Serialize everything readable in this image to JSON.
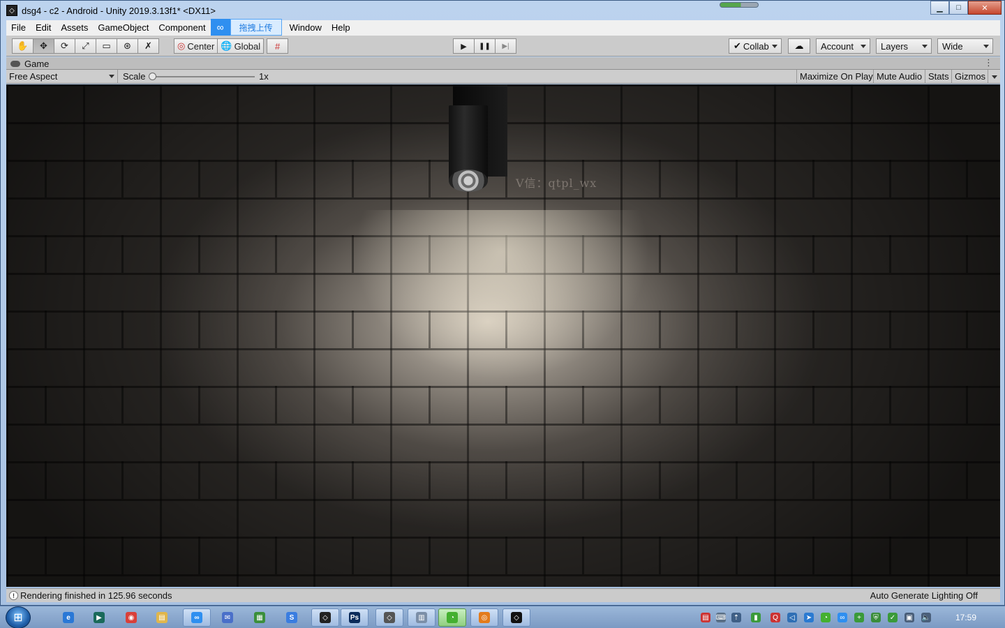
{
  "window": {
    "title": "dsg4 - c2 - Android - Unity 2019.3.13f1* <DX11>",
    "controls": {
      "minimize": "▁",
      "maximize": "□",
      "close": "✕"
    }
  },
  "menu": {
    "items": [
      "File",
      "Edit",
      "Assets",
      "GameObject",
      "Component"
    ],
    "upload_tab": "拖拽上传",
    "items_after": [
      "Window",
      "Help"
    ]
  },
  "toolbar": {
    "tools": [
      {
        "name": "hand-tool",
        "glyph": "✋"
      },
      {
        "name": "move-tool",
        "glyph": "✥"
      },
      {
        "name": "rotate-tool",
        "glyph": "⟳"
      },
      {
        "name": "scale-tool",
        "glyph": "⤢"
      },
      {
        "name": "rect-tool",
        "glyph": "▭"
      },
      {
        "name": "transform-tool",
        "glyph": "⊛"
      },
      {
        "name": "custom-tool",
        "glyph": "✗"
      }
    ],
    "pivot_mode": "Center",
    "pivot_rotation": "Global",
    "snap_glyph": "#",
    "play_glyph": "▶",
    "pause_glyph": "❚❚",
    "step_glyph": "▶|",
    "collab": "Collab",
    "cloud_glyph": "☁",
    "account": "Account",
    "layers": "Layers",
    "layout": "Wide"
  },
  "game_panel": {
    "tab_label": "Game",
    "kebab": "⋮",
    "aspect": "Free Aspect",
    "scale_label": "Scale",
    "scale_value": "1x",
    "scale_level": 0.0,
    "buttons": [
      "Maximize On Play",
      "Mute Audio",
      "Stats",
      "Gizmos"
    ]
  },
  "viewport": {
    "watermark": "V信：qtpl_wx"
  },
  "status": {
    "icon": "!",
    "message": "Rendering finished in 125.96 seconds",
    "lighting": "Auto Generate Lighting Off"
  },
  "taskbar": {
    "start_glyph": "⊞",
    "apps": [
      {
        "name": "ie-icon",
        "glyph": "e",
        "color": "#2a78d6",
        "open": false
      },
      {
        "name": "editor-icon",
        "glyph": "▶",
        "color": "#1a6a5a",
        "open": false
      },
      {
        "name": "chrome-icon",
        "glyph": "◉",
        "color": "#d9403a",
        "open": false
      },
      {
        "name": "folder-icon",
        "glyph": "▤",
        "color": "#e0b64c",
        "open": false
      },
      {
        "name": "baidu-netdisk-icon",
        "glyph": "∞",
        "color": "#2f8ff0",
        "open": true
      },
      {
        "name": "mail-icon",
        "glyph": "✉",
        "color": "#4a6fc9",
        "open": false
      },
      {
        "name": "chart-app-icon",
        "glyph": "▦",
        "color": "#3b8f3b",
        "open": false
      },
      {
        "name": "sogou-icon",
        "glyph": "S",
        "color": "#3a7de0",
        "open": false
      },
      {
        "name": "unity-hub-icon",
        "glyph": "◇",
        "color": "#222222",
        "open": true
      },
      {
        "name": "photoshop-icon",
        "glyph": "Ps",
        "color": "#0b2b5a",
        "open": true
      },
      {
        "name": "unity-task-icon",
        "glyph": "◇",
        "color": "#555555",
        "open": true
      },
      {
        "name": "calculator-icon",
        "glyph": "▥",
        "color": "#7c8fa8",
        "open": true
      },
      {
        "name": "wechat-icon",
        "glyph": "◔",
        "color": "#44b030",
        "open": true,
        "highlight": true
      },
      {
        "name": "browser-icon",
        "glyph": "◎",
        "color": "#e37b1b",
        "open": true
      },
      {
        "name": "unity-editor-icon",
        "glyph": "◇",
        "color": "#111111",
        "open": true
      }
    ],
    "tray": [
      {
        "name": "doc-tray-icon",
        "glyph": "▤",
        "color": "#cc3333"
      },
      {
        "name": "keyboard-tray-icon",
        "glyph": "⌨",
        "color": "#5a6f86"
      },
      {
        "name": "arrow-tray-icon",
        "glyph": "⇡",
        "color": "#3f5f86"
      },
      {
        "name": "battery-tray-icon",
        "glyph": "▮",
        "color": "#3a9a3a"
      },
      {
        "name": "qq-tray-icon",
        "glyph": "Q",
        "color": "#c33"
      },
      {
        "name": "vscode-tray-icon",
        "glyph": "◁",
        "color": "#2f6fb5"
      },
      {
        "name": "cursor-tray-icon",
        "glyph": "➤",
        "color": "#2a7ad1"
      },
      {
        "name": "wechat-tray-icon",
        "glyph": "◔",
        "color": "#44b030"
      },
      {
        "name": "netdisk-tray-icon",
        "glyph": "∞",
        "color": "#2f8ff0"
      },
      {
        "name": "plus-tray-icon",
        "glyph": "+",
        "color": "#3a9a3a"
      },
      {
        "name": "shield-tray-icon",
        "glyph": "⛨",
        "color": "#3a8d3a"
      },
      {
        "name": "check-tray-icon",
        "glyph": "✓",
        "color": "#3a9a3a"
      },
      {
        "name": "network-tray-icon",
        "glyph": "▣",
        "color": "#4a5f7a"
      },
      {
        "name": "volume-tray-icon",
        "glyph": "🔈",
        "color": "#4a5f7a"
      }
    ],
    "clock": "17:59"
  }
}
